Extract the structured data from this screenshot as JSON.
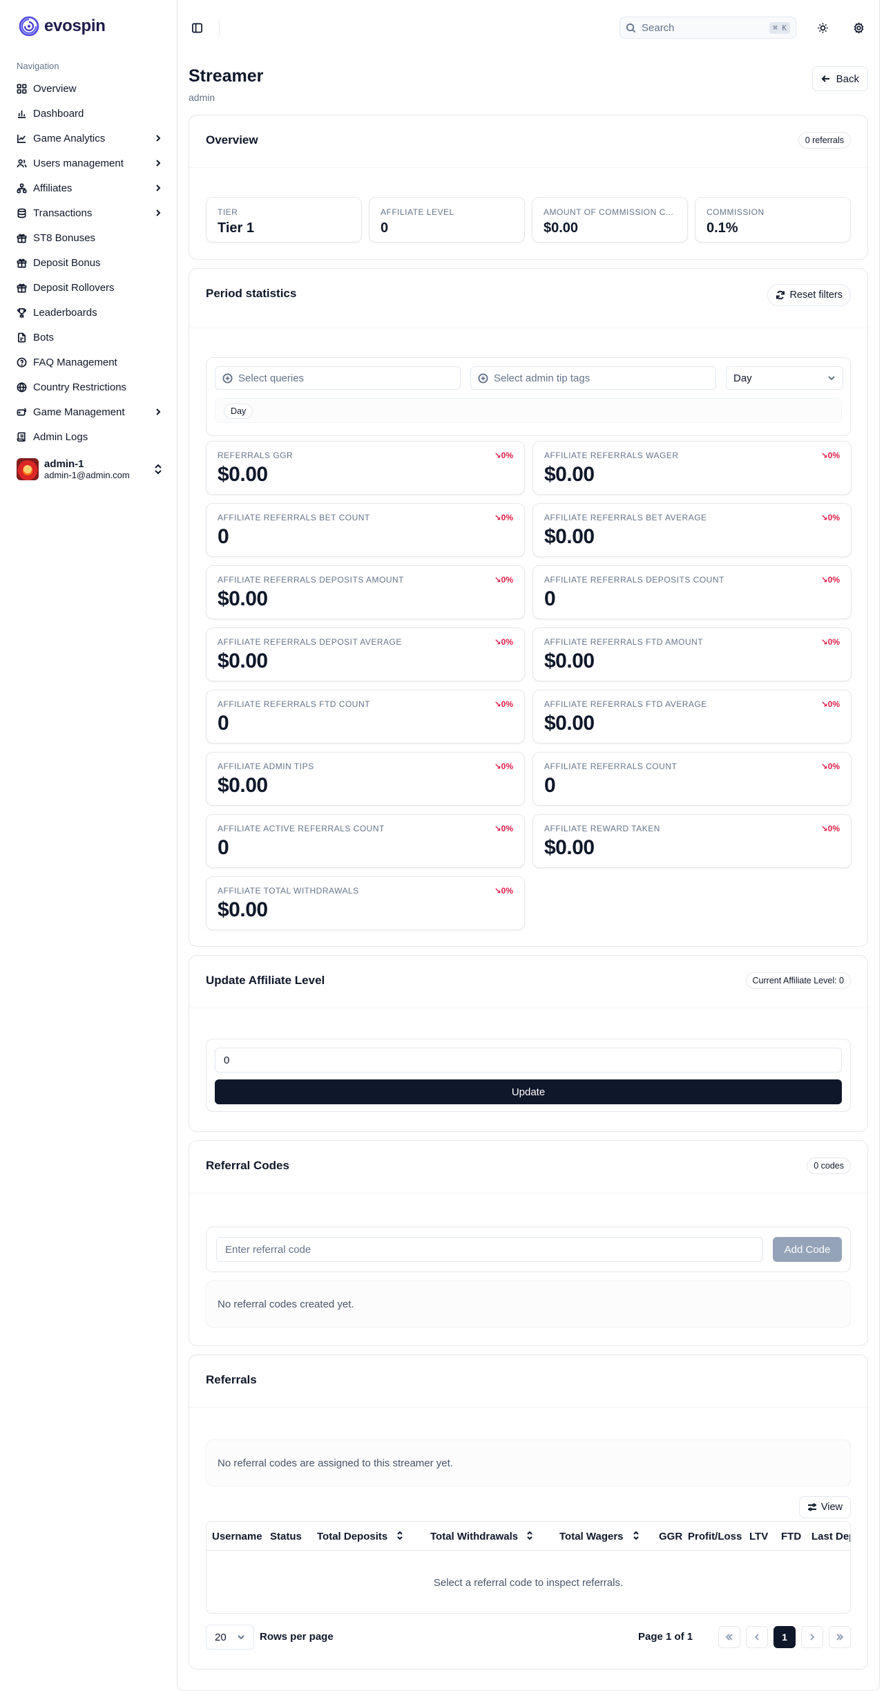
{
  "brand": {
    "name": "evospin",
    "accent": "#4f46e5"
  },
  "sidebar": {
    "section_label": "Navigation",
    "items": [
      {
        "label": "Overview",
        "icon": "layout-grid-icon",
        "has_children": false
      },
      {
        "label": "Dashboard",
        "icon": "bar-chart-icon",
        "has_children": false
      },
      {
        "label": "Game Analytics",
        "icon": "line-chart-icon",
        "has_children": true
      },
      {
        "label": "Users management",
        "icon": "users-icon",
        "has_children": true
      },
      {
        "label": "Affiliates",
        "icon": "network-icon",
        "has_children": true
      },
      {
        "label": "Transactions",
        "icon": "database-icon",
        "has_children": true
      },
      {
        "label": "ST8 Bonuses",
        "icon": "gift-icon",
        "has_children": false
      },
      {
        "label": "Deposit Bonus",
        "icon": "gift-icon",
        "has_children": false
      },
      {
        "label": "Deposit Rollovers",
        "icon": "gift-icon",
        "has_children": false
      },
      {
        "label": "Leaderboards",
        "icon": "trophy-icon",
        "has_children": false
      },
      {
        "label": "Bots",
        "icon": "file-icon",
        "has_children": false
      },
      {
        "label": "FAQ Management",
        "icon": "help-circle-icon",
        "has_children": false
      },
      {
        "label": "Country Restrictions",
        "icon": "globe-icon",
        "has_children": false
      },
      {
        "label": "Game Management",
        "icon": "gamepad-icon",
        "has_children": true
      },
      {
        "label": "Admin Logs",
        "icon": "scroll-icon",
        "has_children": false
      }
    ],
    "user": {
      "name": "admin-1",
      "email": "admin-1@admin.com"
    }
  },
  "topbar": {
    "search_placeholder": "Search",
    "shortcut": "⌘ K"
  },
  "page": {
    "title": "Streamer",
    "subtitle": "admin",
    "back_label": "Back"
  },
  "overview": {
    "title": "Overview",
    "badge": "0 referrals",
    "tiles": [
      {
        "label": "Tier",
        "value": "Tier 1"
      },
      {
        "label": "Affiliate Level",
        "value": "0"
      },
      {
        "label": "Amount of Commission C...",
        "value": "$0.00"
      },
      {
        "label": "Commission",
        "value": "0.1%"
      }
    ]
  },
  "period": {
    "title": "Period statistics",
    "reset_label": "Reset filters",
    "queries_placeholder": "Select queries",
    "tags_placeholder": "Select admin tip tags",
    "interval": "Day",
    "chip": "Day",
    "stats": [
      {
        "label": "Referrals GGR",
        "value": "$0.00",
        "delta": "↘0%"
      },
      {
        "label": "Affiliate Referrals Wager",
        "value": "$0.00",
        "delta": "↘0%"
      },
      {
        "label": "Affiliate Referrals Bet Count",
        "value": "0",
        "delta": "↘0%"
      },
      {
        "label": "Affiliate Referrals Bet Average",
        "value": "$0.00",
        "delta": "↘0%"
      },
      {
        "label": "Affiliate Referrals Deposits Amount",
        "value": "$0.00",
        "delta": "↘0%"
      },
      {
        "label": "Affiliate Referrals Deposits Count",
        "value": "0",
        "delta": "↘0%"
      },
      {
        "label": "Affiliate Referrals Deposit Average",
        "value": "$0.00",
        "delta": "↘0%"
      },
      {
        "label": "Affiliate Referrals FTD Amount",
        "value": "$0.00",
        "delta": "↘0%"
      },
      {
        "label": "Affiliate Referrals FTD Count",
        "value": "0",
        "delta": "↘0%"
      },
      {
        "label": "Affiliate Referrals FTD Average",
        "value": "$0.00",
        "delta": "↘0%"
      },
      {
        "label": "Affiliate Admin Tips",
        "value": "$0.00",
        "delta": "↘0%"
      },
      {
        "label": "Affiliate Referrals Count",
        "value": "0",
        "delta": "↘0%"
      },
      {
        "label": "Affiliate Active Referrals Count",
        "value": "0",
        "delta": "↘0%"
      },
      {
        "label": "Affiliate Reward Taken",
        "value": "$0.00",
        "delta": "↘0%"
      },
      {
        "label": "Affiliate Total Withdrawals",
        "value": "$0.00",
        "delta": "↘0%"
      }
    ]
  },
  "affiliate_level": {
    "title": "Update Affiliate Level",
    "badge": "Current Affiliate Level: 0",
    "input_value": "0",
    "button": "Update"
  },
  "referral_codes": {
    "title": "Referral Codes",
    "badge": "0 codes",
    "input_placeholder": "Enter referral code",
    "add_button": "Add Code",
    "empty": "No referral codes created yet."
  },
  "referrals": {
    "title": "Referrals",
    "empty": "No referral codes are assigned to this streamer yet.",
    "view_button": "View",
    "columns": [
      "Username",
      "Status",
      "Total Deposits",
      "Total Withdrawals",
      "Total Wagers",
      "GGR",
      "Profit/Loss",
      "LTV",
      "FTD",
      "Last Dep"
    ],
    "table_empty": "Select a referral code to inspect referrals.",
    "rows_per_page": "20",
    "rows_per_page_label": "Rows per page",
    "page_info": "Page 1 of 1",
    "current_page": "1"
  }
}
